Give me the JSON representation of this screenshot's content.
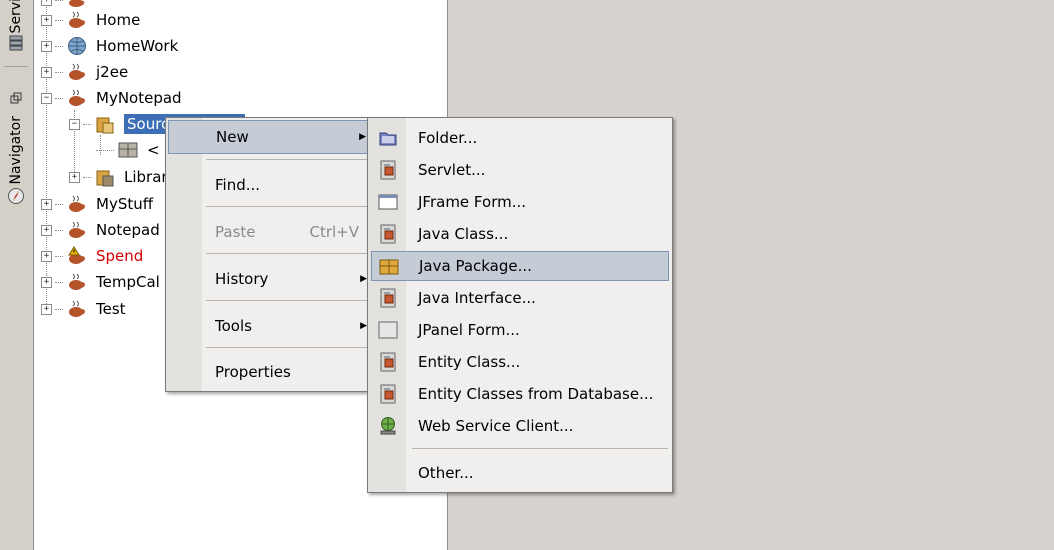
{
  "side_tabs": {
    "services_label": "Servi",
    "navigator_label": "Navigator"
  },
  "tree": {
    "nodes": [
      {
        "label": "Home"
      },
      {
        "label": "HomeWork"
      },
      {
        "label": "j2ee"
      },
      {
        "label": "MyNotepad"
      },
      {
        "label": "Sourc"
      },
      {
        "label": "<"
      },
      {
        "label": "Librar"
      },
      {
        "label": "MyStuff"
      },
      {
        "label": "Notepad"
      },
      {
        "label": "Spend"
      },
      {
        "label": "TempCal"
      },
      {
        "label": "Test"
      }
    ]
  },
  "context_menu": {
    "new": "New",
    "find": "Find...",
    "paste": "Paste",
    "paste_shortcut": "Ctrl+V",
    "history": "History",
    "tools": "Tools",
    "properties": "Properties"
  },
  "new_submenu": {
    "items": [
      {
        "label": "Folder...",
        "icon": "folder-icon"
      },
      {
        "label": "Servlet...",
        "icon": "java-file-icon"
      },
      {
        "label": "JFrame Form...",
        "icon": "jframe-icon"
      },
      {
        "label": "Java Class...",
        "icon": "java-file-icon"
      },
      {
        "label": "Java Package...",
        "icon": "package-icon"
      },
      {
        "label": "Java Interface...",
        "icon": "java-file-icon"
      },
      {
        "label": "JPanel Form...",
        "icon": "jpanel-icon"
      },
      {
        "label": "Entity Class...",
        "icon": "java-file-icon"
      },
      {
        "label": "Entity Classes from Database...",
        "icon": "java-file-icon"
      },
      {
        "label": "Web Service Client...",
        "icon": "web-service-icon"
      },
      {
        "label": "Other...",
        "icon": ""
      }
    ],
    "highlighted": "Java Package..."
  },
  "colors": {
    "selection": "#3d6fb6",
    "menu_highlight": "#c5ccd6",
    "error_text": "#d10000",
    "background": "#d6d3ce"
  }
}
